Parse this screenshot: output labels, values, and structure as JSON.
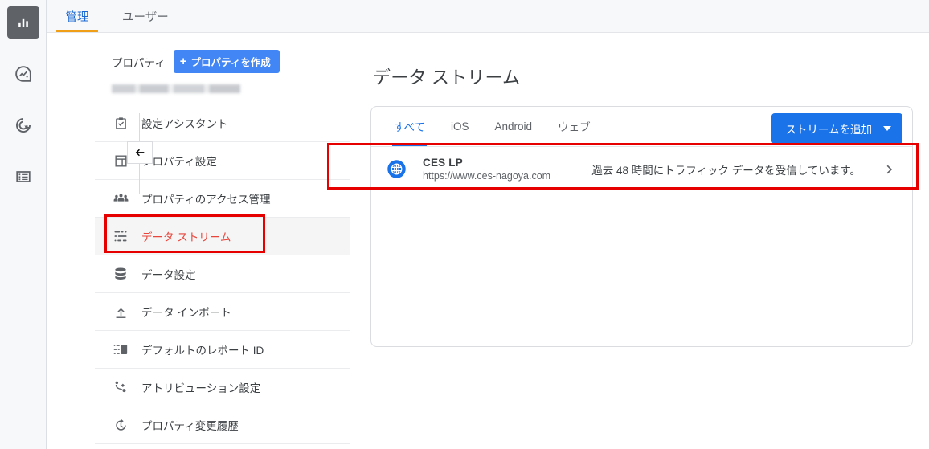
{
  "rail": {
    "items": [
      {
        "name": "reports-icon",
        "active": true
      },
      {
        "name": "explore-icon",
        "active": false
      },
      {
        "name": "advertising-icon",
        "active": false
      },
      {
        "name": "configure-icon",
        "active": false
      }
    ]
  },
  "topbar": {
    "tabs": [
      {
        "label": "管理",
        "active": true
      },
      {
        "label": "ユーザー",
        "active": false
      }
    ]
  },
  "sidebar": {
    "property_label": "プロパティ",
    "create_button": {
      "plus": "+",
      "label": "プロパティを作成"
    },
    "property_name": "",
    "items": [
      {
        "label": "設定アシスタント",
        "icon": "assistant-icon",
        "selected": false
      },
      {
        "label": "プロパティ設定",
        "icon": "property-icon",
        "selected": false
      },
      {
        "label": "プロパティのアクセス管理",
        "icon": "people-icon",
        "selected": false
      },
      {
        "label": "データ ストリーム",
        "icon": "data-stream-icon",
        "selected": true
      },
      {
        "label": "データ設定",
        "icon": "database-icon",
        "selected": false
      },
      {
        "label": "データ インポート",
        "icon": "upload-icon",
        "selected": false
      },
      {
        "label": "デフォルトのレポート ID",
        "icon": "report-id-icon",
        "selected": false
      },
      {
        "label": "アトリビューション設定",
        "icon": "attribution-icon",
        "selected": false
      },
      {
        "label": "プロパティ変更履歴",
        "icon": "history-icon",
        "selected": false
      }
    ],
    "collapse_button": "collapse-arrow-icon"
  },
  "main": {
    "title": "データ ストリーム",
    "tabs": [
      {
        "label": "すべて",
        "active": true
      },
      {
        "label": "iOS",
        "active": false
      },
      {
        "label": "Android",
        "active": false
      },
      {
        "label": "ウェブ",
        "active": false
      }
    ],
    "add_stream_button": "ストリームを追加",
    "streams": [
      {
        "icon": "globe-icon",
        "name": "CES   LP",
        "url": "https://www.ces-nagoya.com",
        "status": "過去 48 時間にトラフィック データを受信しています。",
        "chevron": "chevron-right-icon"
      }
    ]
  },
  "annotations": {
    "highlight_color": "#e60000",
    "boxes": [
      {
        "name": "data-stream-nav-highlight"
      },
      {
        "name": "stream-row-highlight"
      }
    ]
  },
  "colors": {
    "accent_blue": "#1a73e8",
    "tab_underline_orange": "#ef9f18",
    "selected_nav_red": "#e8453c",
    "annotation_red": "#e60000"
  }
}
